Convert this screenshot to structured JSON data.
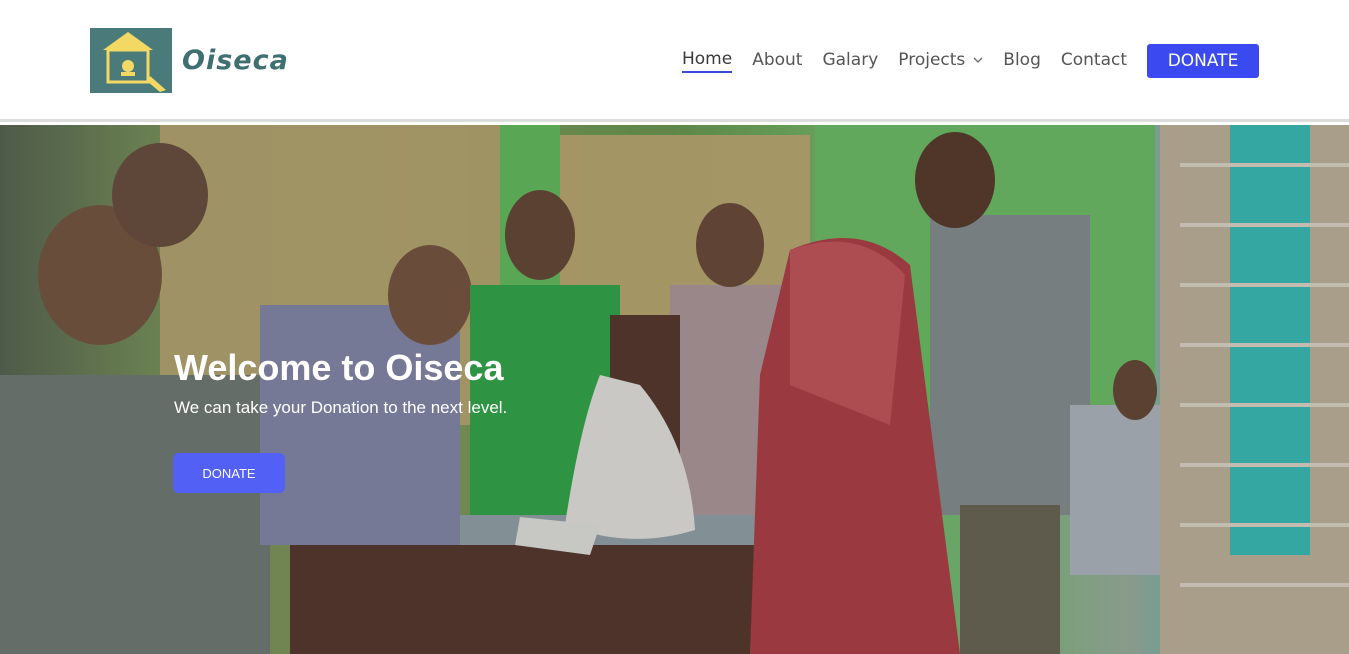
{
  "brand": {
    "name": "Oiseca"
  },
  "nav": {
    "items": [
      {
        "label": "Home"
      },
      {
        "label": "About"
      },
      {
        "label": "Galary"
      },
      {
        "label": "Projects"
      },
      {
        "label": "Blog"
      },
      {
        "label": "Contact"
      }
    ],
    "donate_label": "DONATE"
  },
  "hero": {
    "title": "Welcome to Oiseca",
    "subtitle": "We can take your Donation to the next level.",
    "button_label": "DONATE"
  },
  "colors": {
    "accent": "#3a4af0",
    "logo_text": "#3f6f70",
    "logo_bg": "#4a7a7a"
  }
}
